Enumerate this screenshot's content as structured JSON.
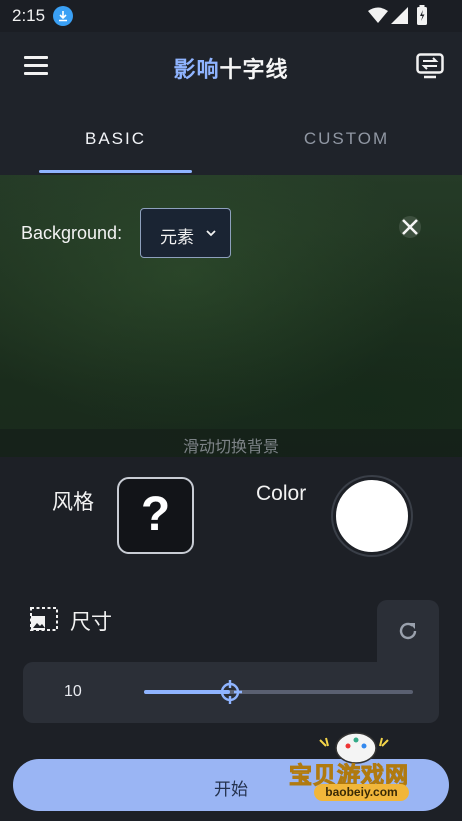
{
  "status_bar": {
    "time": "2:15"
  },
  "app_bar": {
    "title_accent": "影响",
    "title_rest": "十字线"
  },
  "tabs": [
    {
      "label": "BASIC",
      "active": true
    },
    {
      "label": "CUSTOM",
      "active": false
    }
  ],
  "preview": {
    "background_label": "Background:",
    "background_value": "元素",
    "swipe_hint": "滑动切换背景"
  },
  "style": {
    "label": "风格",
    "value_symbol": "?"
  },
  "color": {
    "label": "Color",
    "value": "#ffffff"
  },
  "size": {
    "label": "尺寸",
    "value": "10",
    "slider_fraction": 0.32
  },
  "start_button": {
    "label": "开始"
  },
  "watermark": {
    "text": "宝贝游戏网",
    "sub": "baobeiy.com"
  },
  "colors": {
    "accent": "#8fb4ff",
    "background": "#1d2026",
    "card": "#2b2f37",
    "button": "#9ab5f4"
  },
  "icons": [
    "download-icon",
    "wifi-icon",
    "signal-icon",
    "battery-icon",
    "menu-icon",
    "switch-icon",
    "chevron-down-icon",
    "close-icon",
    "image-size-icon",
    "reset-icon",
    "crosshair-icon"
  ]
}
